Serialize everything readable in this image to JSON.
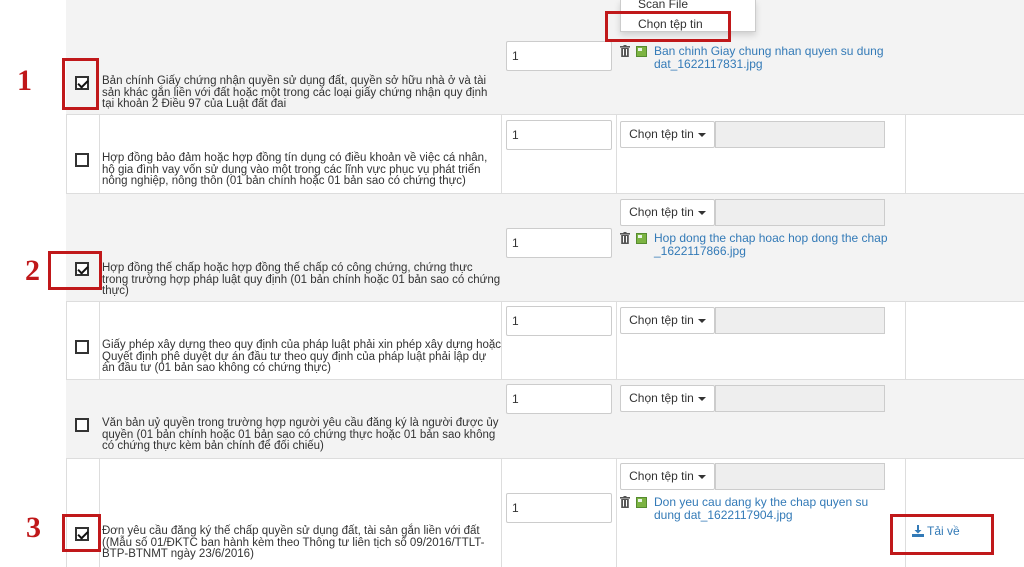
{
  "markers": [
    "1",
    "2",
    "3"
  ],
  "rows": [
    {
      "checked": true,
      "text": "Bản chính Giấy chứng nhận quyền sử dụng đất, quyền sở hữu nhà ở và tài sản khác gắn liền với đất hoặc một trong các loại giấy chứng nhận quy định tại khoản 2 Điều 97 của Luật đất đai",
      "quantity": "1",
      "file": "Ban chinh Giay chung nhan quyen su dung dat_1622117831.jpg"
    },
    {
      "checked": false,
      "text": "Hợp đồng bảo đảm hoặc hợp đồng tín dụng có điều khoản về việc cá nhân, hộ gia đình vay vốn sử dụng vào một trong các lĩnh vực phục vụ phát triển nông nghiệp, nông thôn (01 bản chính hoặc 01 bản sao có chứng thực)",
      "quantity": "1"
    },
    {
      "checked": true,
      "text": "Hợp đồng thế chấp hoặc hợp đồng thế chấp có công chứng, chứng thực trong trường hợp pháp luật quy định (01 bản chính hoặc 01 bản sao có chứng thực)",
      "quantity": "1",
      "file": "Hop dong the chap hoac hop dong the chap _1622117866.jpg"
    },
    {
      "checked": false,
      "text": "Giấy phép xây dựng theo quy định của pháp luật phải xin phép xây dựng hoặc Quyết định phê duyệt dự án đầu tư theo quy định của pháp luật phải lập dự án đầu tư (01 bản sao không có chứng thực)",
      "quantity": "1"
    },
    {
      "checked": false,
      "text": "Văn bản uỷ quyền trong trường hợp người yêu cầu đăng ký là người được ủy quyền (01 bản chính hoặc 01 bản sao có chứng thực hoặc 01 bản sao không có chứng thực kèm bản chính để đối chiếu)",
      "quantity": "1"
    },
    {
      "checked": true,
      "text": "Đơn yêu cầu đăng ký thế chấp quyền sử dụng đất, tài sản gắn liền với đất ((Mẫu số 01/ĐKTC ban hành kèm theo Thông tư liên tịch số 09/2016/TTLT-BTP-BTNMT ngày 23/6/2016)",
      "quantity": "1",
      "file": "Don yeu cau dang ky the chap quyen su dung dat_1622117904.jpg"
    }
  ],
  "choose_file_label": "Chọn tệp tin",
  "dropdown": {
    "items": [
      "Scan File",
      "Chọn tệp tin"
    ]
  },
  "download_label": "Tải về",
  "colors": {
    "annotation": "#c0181a",
    "link": "#337ab7",
    "row_shade": "#f3f3f3"
  }
}
